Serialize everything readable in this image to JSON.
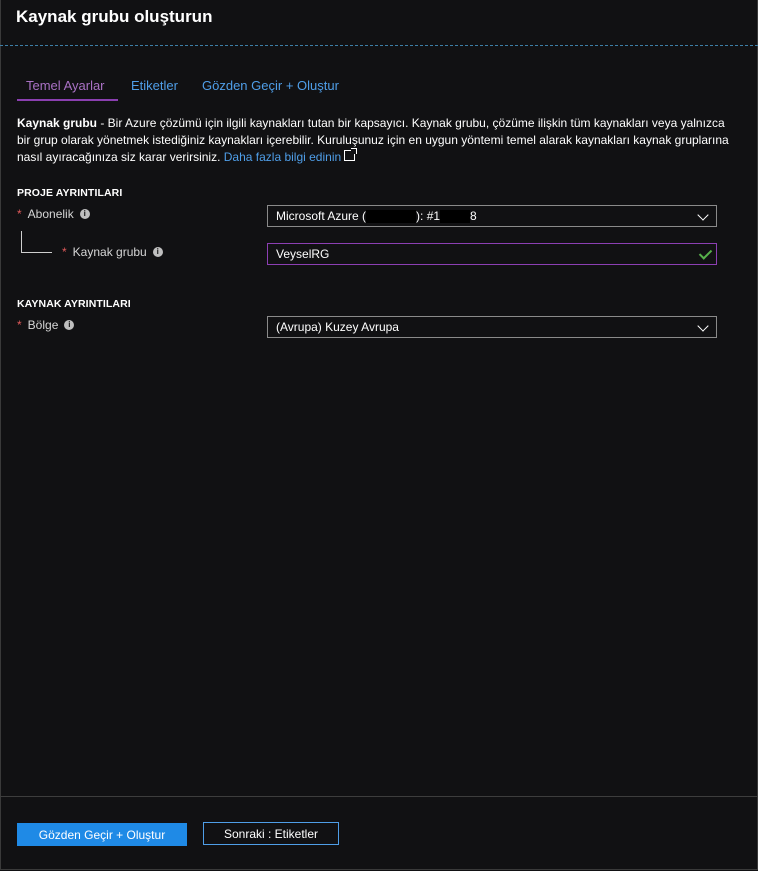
{
  "header": {
    "title": "Kaynak grubu oluşturun"
  },
  "tabs": [
    {
      "label": "Temel Ayarlar"
    },
    {
      "label": "Etiketler"
    },
    {
      "label": "Gözden Geçir + Oluştur"
    }
  ],
  "description": {
    "bold": "Kaynak grubu",
    "text": " - Bir Azure çözümü için ilgili kaynakları tutan bir kapsayıcı. Kaynak grubu, çözüme ilişkin tüm kaynakları veya yalnızca bir grup olarak yönetmek istediğiniz kaynakları içerebilir. Kuruluşunuz için en uygun yöntemi temel alarak kaynakları kaynak gruplarına nasıl ayıracağınıza siz karar verirsiniz. ",
    "link": "Daha fazla bilgi edinin"
  },
  "project": {
    "section_title": "PROJE AYRINTILARI",
    "subscription_label": "Abonelik",
    "subscription_value_prefix": "Microsoft Azure (",
    "subscription_value_mid": "): #1",
    "subscription_value_end": "8",
    "resource_group_label": "Kaynak grubu",
    "resource_group_value": "VeyselRG"
  },
  "resource": {
    "section_title": "KAYNAK AYRINTILARI",
    "region_label": "Bölge",
    "region_value": "(Avrupa) Kuzey Avrupa"
  },
  "footer": {
    "primary_label": "Gözden Geçir + Oluştur",
    "secondary_label": "Sonraki : Etiketler"
  },
  "colors": {
    "accent_blue": "#1f8ae6",
    "link_blue": "#4f9ee8",
    "active_tab_purple": "#8a3fb0",
    "required_red": "#e05a5a",
    "valid_green": "#57b04b"
  }
}
